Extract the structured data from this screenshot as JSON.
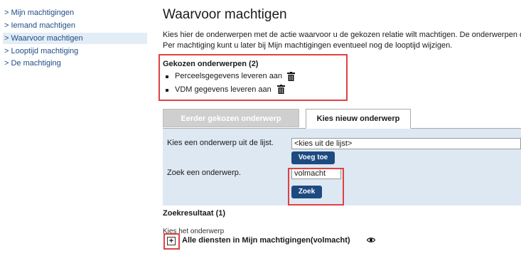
{
  "sidebar": {
    "items": [
      {
        "label": "> Mijn machtigingen"
      },
      {
        "label": "> Iemand machtigen"
      },
      {
        "label": "> Waarvoor machtigen"
      },
      {
        "label": "> Looptijd machtiging"
      },
      {
        "label": "> De machtiging"
      }
    ],
    "active_index": 2
  },
  "main": {
    "title": "Waarvoor machtigen",
    "intro_line1": "Kies hier de onderwerpen met de actie waarvoor u de gekozen relatie wilt machtigen. De onderwerpen die",
    "intro_line2": "Per machtiging kunt u later bij Mijn machtigingen eventueel nog de looptijd wijzigen.",
    "chosen": {
      "heading": "Gekozen onderwerpen (2)",
      "items": [
        {
          "label": "Perceelsgegevens leveren aan",
          "icon": "trash-icon"
        },
        {
          "label": "VDM gegevens leveren aan",
          "icon": "trash-icon"
        }
      ]
    },
    "tabs": [
      {
        "label": "Eerder gekozen onderwerp",
        "active": false
      },
      {
        "label": "Kies nieuw onderwerp",
        "active": true
      }
    ],
    "panel": {
      "choose_label": "Kies een onderwerp uit de lijst.",
      "choose_select_value": "<kies uit de lijst>",
      "add_button": "Voeg toe",
      "search_label": "Zoek een onderwerp.",
      "search_value": "volmacht",
      "search_button": "Zoek"
    },
    "results": {
      "heading": "Zoekresultaat (1)",
      "subheading": "Kies het onderwerp",
      "items": [
        {
          "label": "Alle diensten in Mijn machtigingen(volmacht)",
          "expand_icon": "plus-icon",
          "view_icon": "eye-icon"
        }
      ]
    }
  },
  "colors": {
    "link": "#1f4c86",
    "active_nav_bg": "#e3edf6",
    "panel_bg": "#dde8f3",
    "button_bg": "#1d4a80",
    "highlight_border": "#e04141",
    "inactive_tab_bg": "#cfcfcf"
  }
}
